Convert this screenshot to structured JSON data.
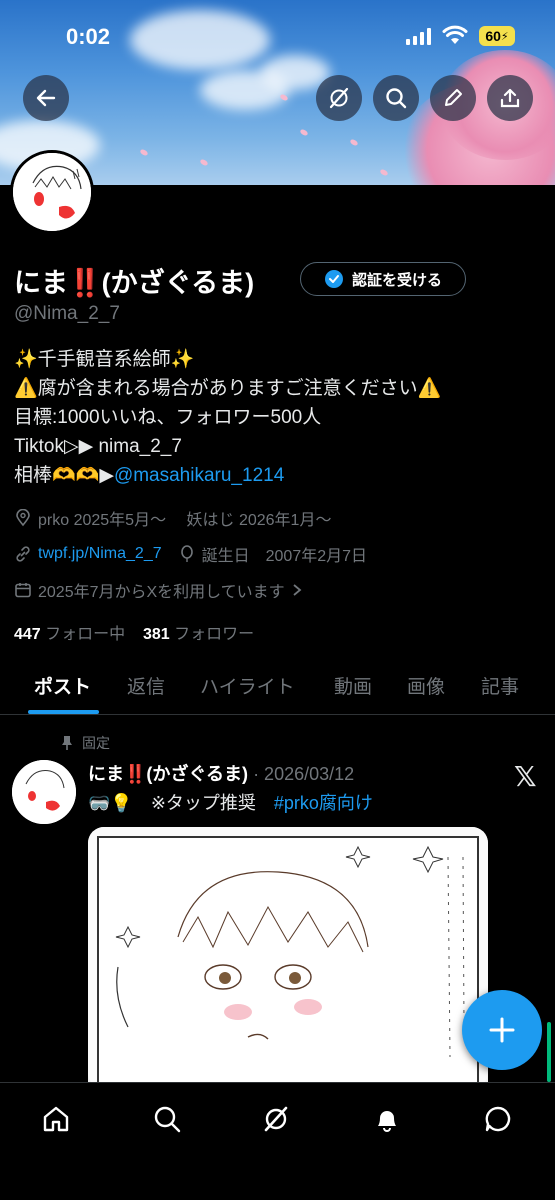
{
  "status_bar": {
    "time": "0:02",
    "battery": "60"
  },
  "profile": {
    "name": "にま‼️(かざぐるま)",
    "verify_label": "認証を受ける",
    "handle": "@Nima_2_7",
    "bio_lines": [
      "✨千手観音系絵師✨",
      "⚠️腐が含まれる場合がありますご注意ください⚠️",
      "目標:1000いいね、フォロワー500人",
      "Tiktok▷▶︎ nima_2_7"
    ],
    "bio_partner_prefix": "相棒🫶🫶▶︎",
    "bio_partner_link": "@masahikaru_1214",
    "location": "prko 2025年5月〜　 妖はじ 2026年1月〜",
    "website": "twpf.jp/Nima_2_7",
    "birthday": "誕生日　2007年2月7日",
    "joined": "2025年7月からXを利用しています",
    "following_count": "447",
    "following_label": "フォロー中",
    "followers_count": "381",
    "followers_label": "フォロワー"
  },
  "tabs": [
    "ポスト",
    "返信",
    "ハイライト",
    "動画",
    "画像",
    "記事"
  ],
  "pinned_post": {
    "pinned_label": "固定",
    "name": "にま‼️(かざぐるま)",
    "date": "· 2026/03/12",
    "text_prefix": "🥽💡　※タップ推奨　",
    "hashtag": "#prko腐向け"
  },
  "colors": {
    "accent": "#1d9bf0",
    "background": "#000000",
    "muted": "#71767b"
  },
  "icons": {
    "banner": [
      "back-arrow-icon",
      "grok-icon",
      "search-icon",
      "edit-pencil-icon",
      "share-icon"
    ],
    "nav": [
      "home-icon",
      "search-icon",
      "grok-icon",
      "bell-icon",
      "message-icon"
    ]
  }
}
